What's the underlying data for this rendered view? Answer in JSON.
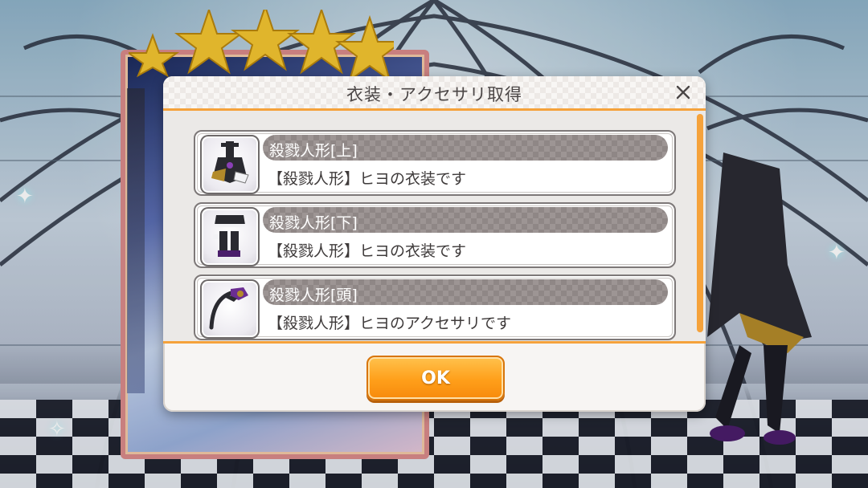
{
  "dialog": {
    "title": "衣装・アクセサリ取得",
    "close_icon": "close-x-icon",
    "ok_label": "OK",
    "accent_color": "#f5a23b"
  },
  "items": [
    {
      "name": "殺戮人形[上]",
      "description": "【殺戮人形】ヒヨの衣装です",
      "icon": "top-costume-icon"
    },
    {
      "name": "殺戮人形[下]",
      "description": "【殺戮人形】ヒヨの衣装です",
      "icon": "bottom-costume-icon"
    },
    {
      "name": "殺戮人形[頭]",
      "description": "【殺戮人形】ヒヨのアクセサリです",
      "icon": "head-accessory-icon"
    }
  ],
  "card": {
    "rarity_stars": 5
  }
}
